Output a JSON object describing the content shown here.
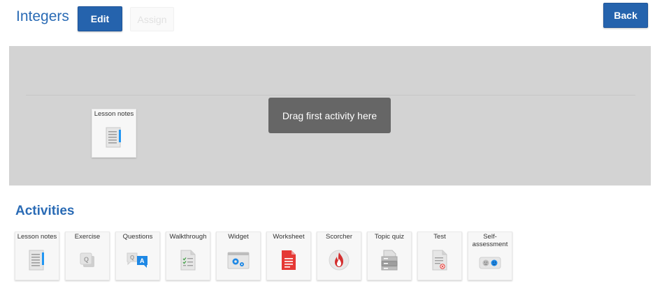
{
  "header": {
    "title": "Integers",
    "edit_label": "Edit",
    "assign_label": "Assign",
    "back_label": "Back"
  },
  "canvas": {
    "hint": "Drag first activity here",
    "placed_activity": {
      "label": "Lesson notes",
      "icon": "lesson-notes-icon"
    }
  },
  "activities": {
    "title": "Activities",
    "items": [
      {
        "label": "Lesson notes",
        "icon": "lesson-notes-icon"
      },
      {
        "label": "Exercise",
        "icon": "exercise-icon"
      },
      {
        "label": "Questions",
        "icon": "questions-icon"
      },
      {
        "label": "Walkthrough",
        "icon": "walkthrough-icon"
      },
      {
        "label": "Widget",
        "icon": "widget-icon"
      },
      {
        "label": "Worksheet",
        "icon": "worksheet-icon"
      },
      {
        "label": "Scorcher",
        "icon": "scorcher-icon"
      },
      {
        "label": "Topic quiz",
        "icon": "topic-quiz-icon"
      },
      {
        "label": "Test",
        "icon": "test-icon"
      },
      {
        "label": "Self-assessment",
        "icon": "self-assessment-icon"
      }
    ]
  },
  "colors": {
    "accent": "#2563ad",
    "title": "#2a6bb5",
    "drop_zone": "#d3d3d3",
    "hint_bg": "#666666",
    "worksheet_red": "#e53935",
    "scorcher_red": "#d32f2f"
  }
}
